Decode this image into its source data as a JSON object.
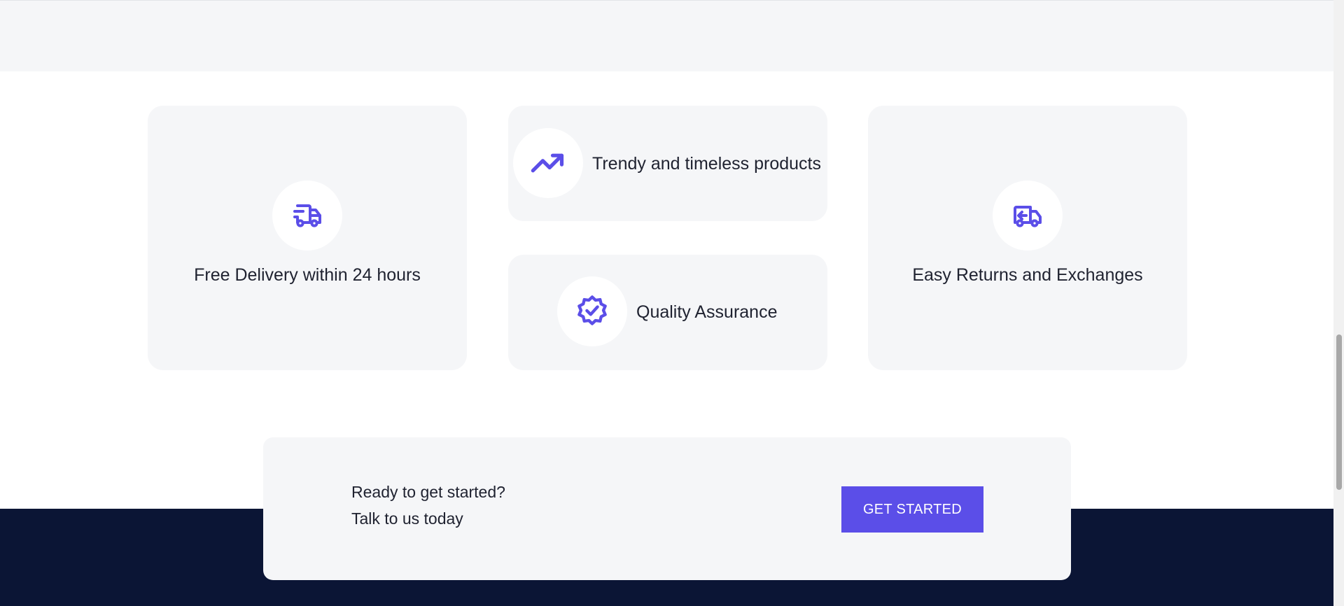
{
  "colors": {
    "accent": "#5b4ee8",
    "card_background": "#f5f6f8",
    "footer_background": "#0b1535"
  },
  "features": {
    "delivery": {
      "label": "Free Delivery within 24 hours",
      "icon": "truck-icon"
    },
    "trendy": {
      "label": "Trendy and timeless products",
      "icon": "trending-up-icon"
    },
    "quality": {
      "label": "Quality Assurance",
      "icon": "verified-badge-icon"
    },
    "returns": {
      "label": "Easy Returns and Exchanges",
      "icon": "truck-return-icon"
    }
  },
  "cta": {
    "line1": "Ready to get started?",
    "line2": "Talk to us today",
    "button_label": "GET STARTED"
  }
}
